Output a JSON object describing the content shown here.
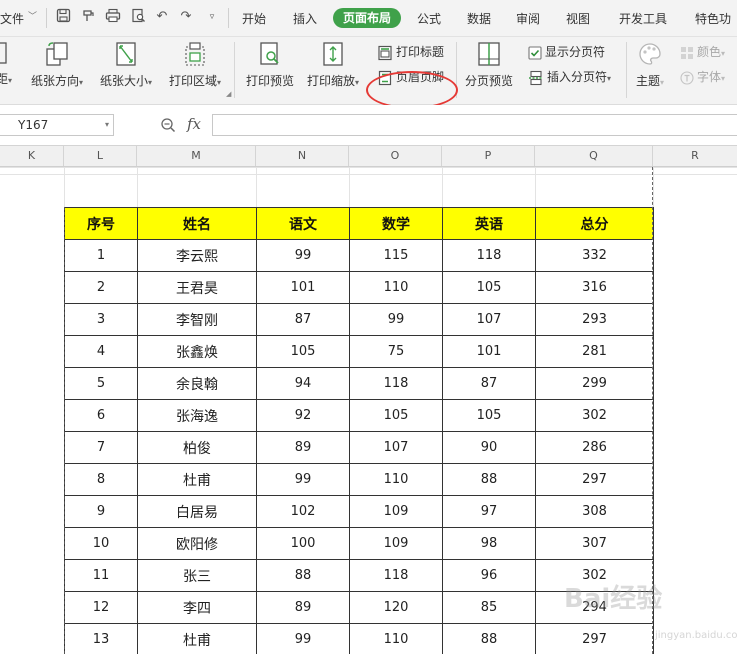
{
  "menu": {
    "file": "文件",
    "tabs": [
      "开始",
      "插入",
      "页面布局",
      "公式",
      "数据",
      "审阅",
      "视图",
      "开发工具",
      "特色功"
    ],
    "active_tab": "页面布局"
  },
  "ribbon": {
    "margins_partial": "距",
    "orientation": "纸张方向",
    "paper_size": "纸张大小",
    "print_area": "打印区域",
    "print_preview": "打印预览",
    "print_scale": "打印缩放",
    "print_titles": "打印标题",
    "header_footer": "页眉页脚",
    "page_break_preview": "分页预览",
    "show_page_breaks": "显示分页符",
    "insert_page_break": "插入分页符",
    "theme": "主题",
    "colors": "颜色",
    "fonts": "字体"
  },
  "formula_bar": {
    "name_box": "Y167",
    "fx": "fx",
    "formula": ""
  },
  "columns": [
    "K",
    "L",
    "M",
    "N",
    "O",
    "P",
    "Q",
    "R"
  ],
  "table": {
    "headers": [
      "序号",
      "姓名",
      "语文",
      "数学",
      "英语",
      "总分"
    ],
    "rows": [
      [
        "1",
        "李云熙",
        "99",
        "115",
        "118",
        "332"
      ],
      [
        "2",
        "王君昊",
        "101",
        "110",
        "105",
        "316"
      ],
      [
        "3",
        "李智刚",
        "87",
        "99",
        "107",
        "293"
      ],
      [
        "4",
        "张鑫焕",
        "105",
        "75",
        "101",
        "281"
      ],
      [
        "5",
        "余良翰",
        "94",
        "118",
        "87",
        "299"
      ],
      [
        "6",
        "张海逸",
        "92",
        "105",
        "105",
        "302"
      ],
      [
        "7",
        "柏俊",
        "89",
        "107",
        "90",
        "286"
      ],
      [
        "8",
        "杜甫",
        "99",
        "110",
        "88",
        "297"
      ],
      [
        "9",
        "白居易",
        "102",
        "109",
        "97",
        "308"
      ],
      [
        "10",
        "欧阳修",
        "100",
        "109",
        "98",
        "307"
      ],
      [
        "11",
        "张三",
        "88",
        "118",
        "96",
        "302"
      ],
      [
        "12",
        "李四",
        "89",
        "120",
        "85",
        "294"
      ],
      [
        "13",
        "杜甫",
        "99",
        "110",
        "88",
        "297"
      ]
    ]
  },
  "watermark": {
    "main": "Bai经验",
    "sub": "jingyan.baidu.com"
  },
  "colors": {
    "active_tab": "#3fa14a",
    "header_fill": "#ffff00",
    "highlight_circle": "#e53935"
  }
}
